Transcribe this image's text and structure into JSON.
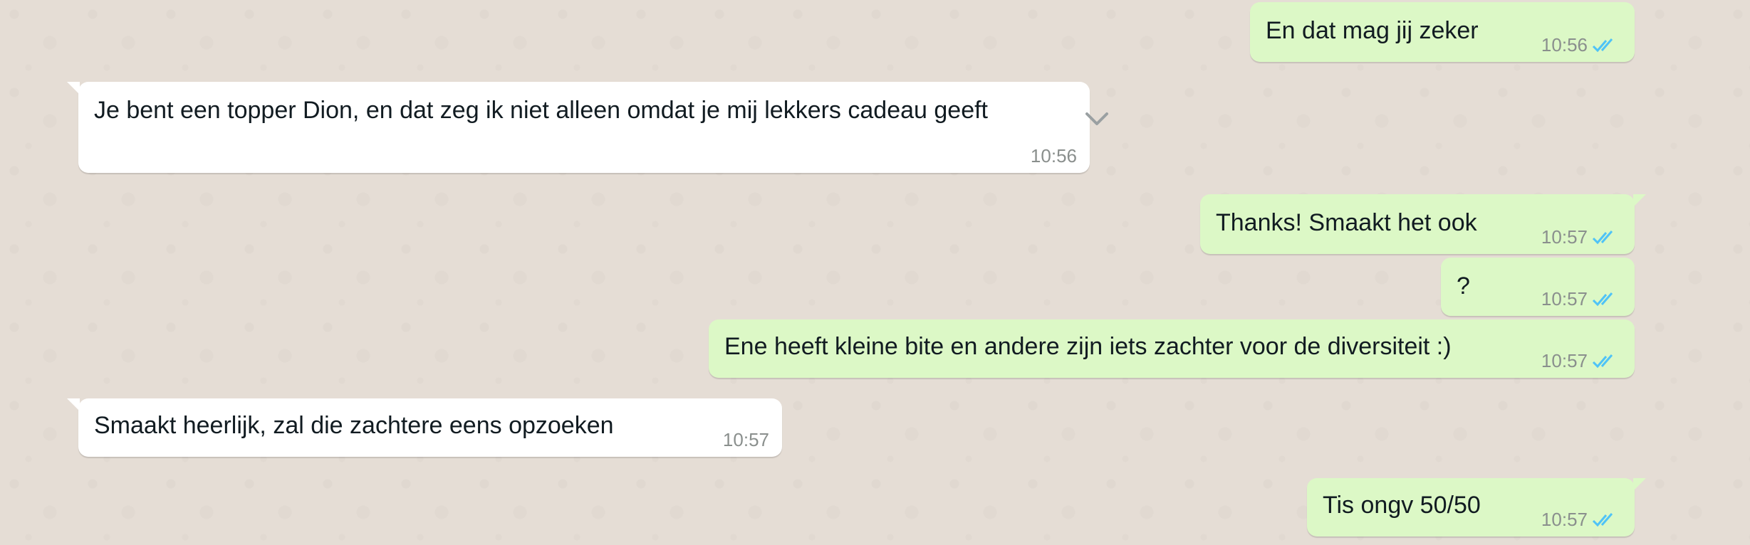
{
  "conversation": {
    "messages": [
      {
        "direction": "outgoing",
        "text": "En dat mag jij zeker",
        "time": "10:56",
        "status": "read"
      },
      {
        "direction": "incoming",
        "text": "Je bent een topper Dion, en dat zeg ik niet alleen omdat je mij lekkers cadeau geeft",
        "time": "10:56",
        "truncated": true
      },
      {
        "direction": "outgoing",
        "text": "Thanks! Smaakt het ook",
        "time": "10:57",
        "status": "read"
      },
      {
        "direction": "outgoing",
        "text": "?",
        "time": "10:57",
        "status": "read"
      },
      {
        "direction": "outgoing",
        "text": "Ene heeft kleine bite en andere zijn iets zachter voor de diversiteit :)",
        "time": "10:57",
        "status": "read"
      },
      {
        "direction": "incoming",
        "text": "Smaakt heerlijk, zal die zachtere eens opzoeken",
        "time": "10:57"
      },
      {
        "direction": "outgoing",
        "text": "Tis ongv 50/50",
        "time": "10:57",
        "status": "read"
      }
    ]
  },
  "icons": {
    "read_receipt": "double-check-icon",
    "expand": "chevron-down-icon"
  },
  "colors": {
    "background": "#e5ddd5",
    "incoming_bubble": "#ffffff",
    "outgoing_bubble": "#dcf8c6",
    "read_tick": "#4fc3f7",
    "timestamp": "#8a8f8d"
  }
}
